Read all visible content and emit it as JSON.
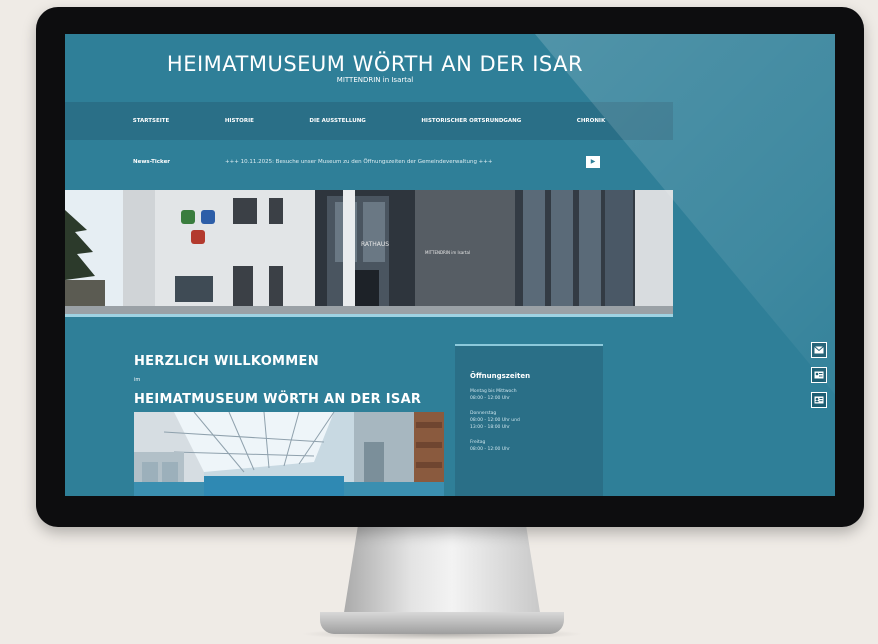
{
  "site": {
    "title": "HEIMATMUSEUM WÖRTH AN DER ISAR",
    "subtitle": "MITTENDRIN in Isartal"
  },
  "nav": {
    "items": [
      {
        "label": "STARTSEITE"
      },
      {
        "label": "HISTORIE"
      },
      {
        "label": "DIE AUSSTELLUNG"
      },
      {
        "label": "HISTORISCHER ORTSRUNDGANG"
      },
      {
        "label": "CHRONIK"
      }
    ]
  },
  "ticker": {
    "label": "News-Ticker",
    "text": "+++ 10.11.2025: Besuche unser Museum zu den Öffnungszeiten der Gemeindeverwaltung +++",
    "button": "▶"
  },
  "hero": {
    "sign_rathaus": "RATHAUS",
    "sign_mittendrin": "MITTENDRIN im Isartal"
  },
  "welcome": {
    "title": "HERZLICH WILLKOMMEN",
    "im": "im",
    "museum": "HEIMATMUSEUM WÖRTH AN DER ISAR"
  },
  "hours": {
    "title": "Öffnungszeiten",
    "blocks": [
      {
        "lines": [
          "Montag bis Mittwoch",
          "08:00 - 12:00 Uhr"
        ]
      },
      {
        "lines": [
          "Donnerstag",
          "08:00 - 12:00 Uhr  und",
          "13:00 - 18:00 Uhr"
        ]
      },
      {
        "lines": [
          "Freitag",
          "08:00 - 12:00 Uhr"
        ]
      }
    ]
  },
  "side_icons": [
    "mail-icon",
    "contact-card-icon",
    "id-card-icon"
  ],
  "colors": {
    "screen_bg": "#2f7f98",
    "nav_bg": "#2a6f87",
    "page_bg": "#efebe6"
  }
}
